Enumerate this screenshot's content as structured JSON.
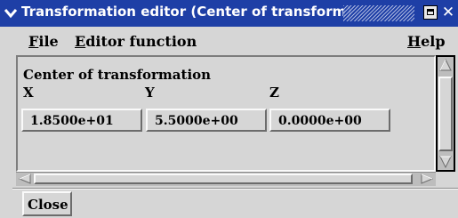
{
  "window": {
    "title": "Transformation editor (Center of transform)",
    "menu_icon": "chevron-down-icon",
    "minimize_icon": "minimize-icon",
    "close_icon": "close-icon",
    "close_glyph": "✕"
  },
  "menubar": {
    "file": {
      "mnemonic": "F",
      "rest": "ile"
    },
    "editor_function": {
      "mnemonic": "E",
      "rest": "ditor function"
    },
    "help": {
      "mnemonic": "H",
      "rest": "elp"
    }
  },
  "center": {
    "section_title": "Center of transformation",
    "x_label": "X",
    "y_label": "Y",
    "z_label": "Z",
    "x_value": "1.8500e+01",
    "y_value": "5.5000e+00",
    "z_value": "0.0000e+00"
  },
  "buttons": {
    "close_label": "Close"
  },
  "colors": {
    "titlebar": "#1e3fa6",
    "background": "#d6d6d6",
    "scroll_trough": "#bdbdbd"
  }
}
